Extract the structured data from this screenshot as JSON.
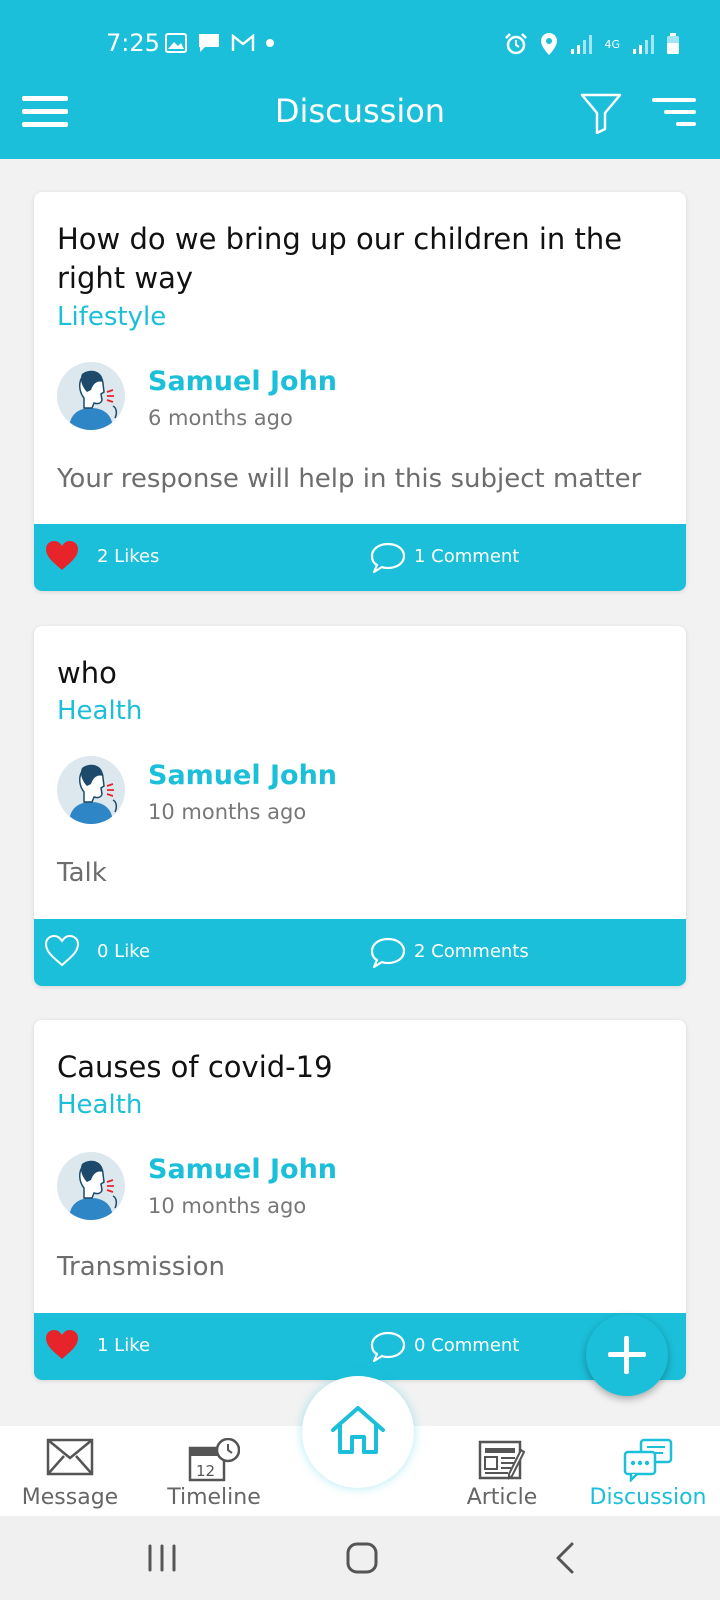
{
  "status_bar": {
    "time": "7:25",
    "network": "4G"
  },
  "toolbar": {
    "title": "Discussion"
  },
  "posts": [
    {
      "title": "How do we bring up our children in the right way",
      "category": "Lifestyle",
      "author": "Samuel John",
      "time_ago": "6 months ago",
      "body": "Your response will help in this subject matter",
      "likes_label": "2 Likes",
      "liked": true,
      "comments_label": "1 Comment"
    },
    {
      "title": "who",
      "category": "Health",
      "author": "Samuel John",
      "time_ago": "10 months ago",
      "body": "Talk",
      "likes_label": "0 Like",
      "liked": false,
      "comments_label": "2 Comments"
    },
    {
      "title": "Causes of covid-19",
      "category": "Health",
      "author": "Samuel John",
      "time_ago": "10 months ago",
      "body": "Transmission",
      "likes_label": "1 Like",
      "liked": true,
      "comments_label": "0 Comment"
    }
  ],
  "bottom_nav": {
    "message": "Message",
    "timeline": "Timeline",
    "timeline_day": "12",
    "article": "Article",
    "discussion": "Discussion"
  },
  "colors": {
    "accent": "#1bbfd9",
    "like": "#e8242b"
  },
  "icons": {
    "menu": "hamburger-icon",
    "filter": "filter-icon",
    "sort": "sort-icon",
    "like": "heart-icon",
    "comment": "comment-bubble-icon",
    "add": "plus-icon",
    "home": "home-icon"
  }
}
